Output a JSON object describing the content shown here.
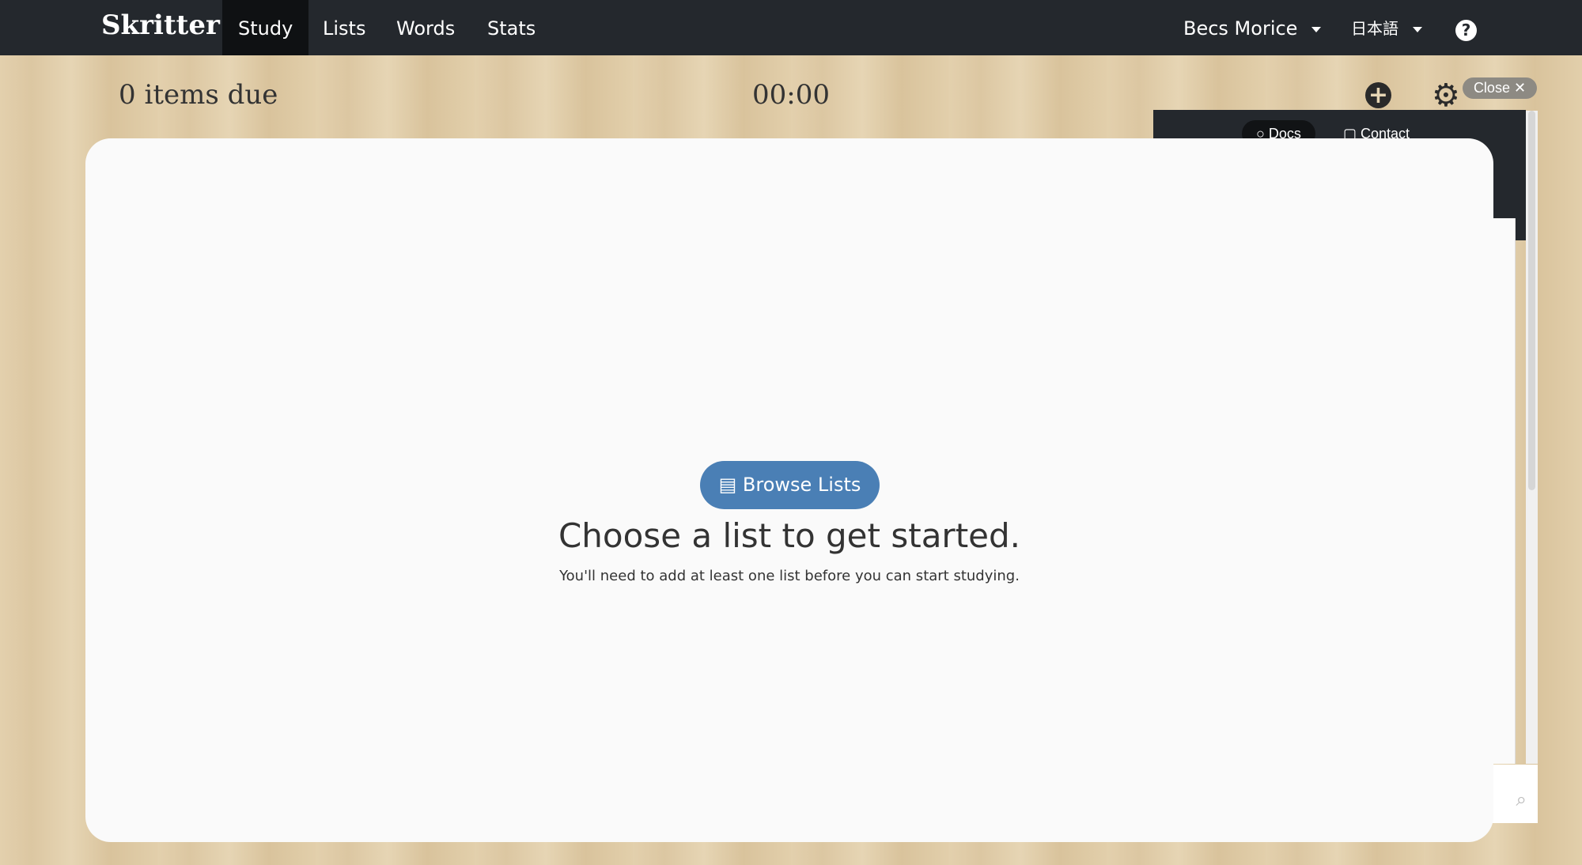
{
  "nav": {
    "logo": "Skritter",
    "tabs": [
      "Study",
      "Lists",
      "Words",
      "Stats"
    ],
    "active_tab": "Study",
    "user": "Becs Morice",
    "language": "日本語",
    "help_icon": "question-circle-icon"
  },
  "toolbar": {
    "items_due": "0 items due",
    "timer": "00:00",
    "add_icon": "plus-circle-icon",
    "settings_icon": "gear-icon"
  },
  "help_panel": {
    "close_label": "Close ✕",
    "tabs": [
      "Docs",
      "Contact"
    ],
    "search_icon": "search-icon"
  },
  "main": {
    "heading": "Choose a list to get started.",
    "subtext": "You'll need to add at least one list before you can start studying.",
    "button_label": "Browse Lists",
    "button_icon": "list-icon",
    "accent": "#4a7fb5"
  }
}
